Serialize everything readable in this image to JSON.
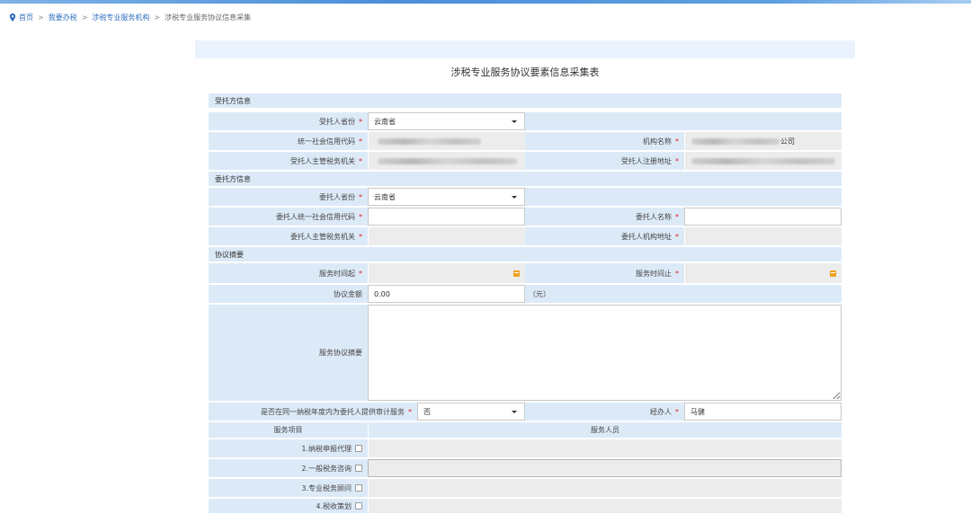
{
  "breadcrumb": {
    "items": [
      "首页",
      "我要办税",
      "涉税专业服务机构",
      "涉税专业服务协议信息采集"
    ],
    "separator": ">"
  },
  "form": {
    "title": "涉税专业服务协议要素信息采集表",
    "sections": {
      "trustee": "受托方信息",
      "client": "委托方信息",
      "summary": "协议摘要"
    },
    "trustee": {
      "province_label": "受托人省份",
      "province_value": "云南省",
      "credit_code_label": "统一社会信用代码",
      "org_name_label": "机构名称",
      "org_name_tail": "公司",
      "tax_authority_label": "受托人主管税务机关",
      "reg_address_label": "受托人注册地址"
    },
    "client": {
      "province_label": "委托人省份",
      "province_value": "云南省",
      "credit_code_label": "委托人统一社会信用代码",
      "name_label": "委托人名称",
      "tax_authority_label": "委托人主管税务机关",
      "address_label": "委托人机构地址"
    },
    "summary": {
      "start_label": "服务时间起",
      "end_label": "服务时间止",
      "amount_label": "协议金额",
      "amount_value": "0.00",
      "amount_unit": "（元）",
      "abstract_label": "服务协议摘要",
      "audit_label": "是否在同一纳税年度内为委托人提供审计服务",
      "audit_value": "否",
      "handler_label": "经办人",
      "handler_value": "马健"
    },
    "services": {
      "col_project": "服务项目",
      "col_staff": "服务人员",
      "items": [
        "1.纳税申报代理",
        "2.一般税务咨询",
        "3.专业税务顾问",
        "4.税收策划"
      ]
    },
    "required_mark": "*"
  },
  "colors": {
    "label_bg": "#dceaf8",
    "readonly_bg": "#ececec",
    "link": "#2f6fbf",
    "required": "#e02020",
    "calendar": "#f0a020"
  },
  "icons": {
    "location": "location-pin-icon",
    "calendar": "calendar-icon",
    "dropdown": "chevron-down-icon"
  }
}
